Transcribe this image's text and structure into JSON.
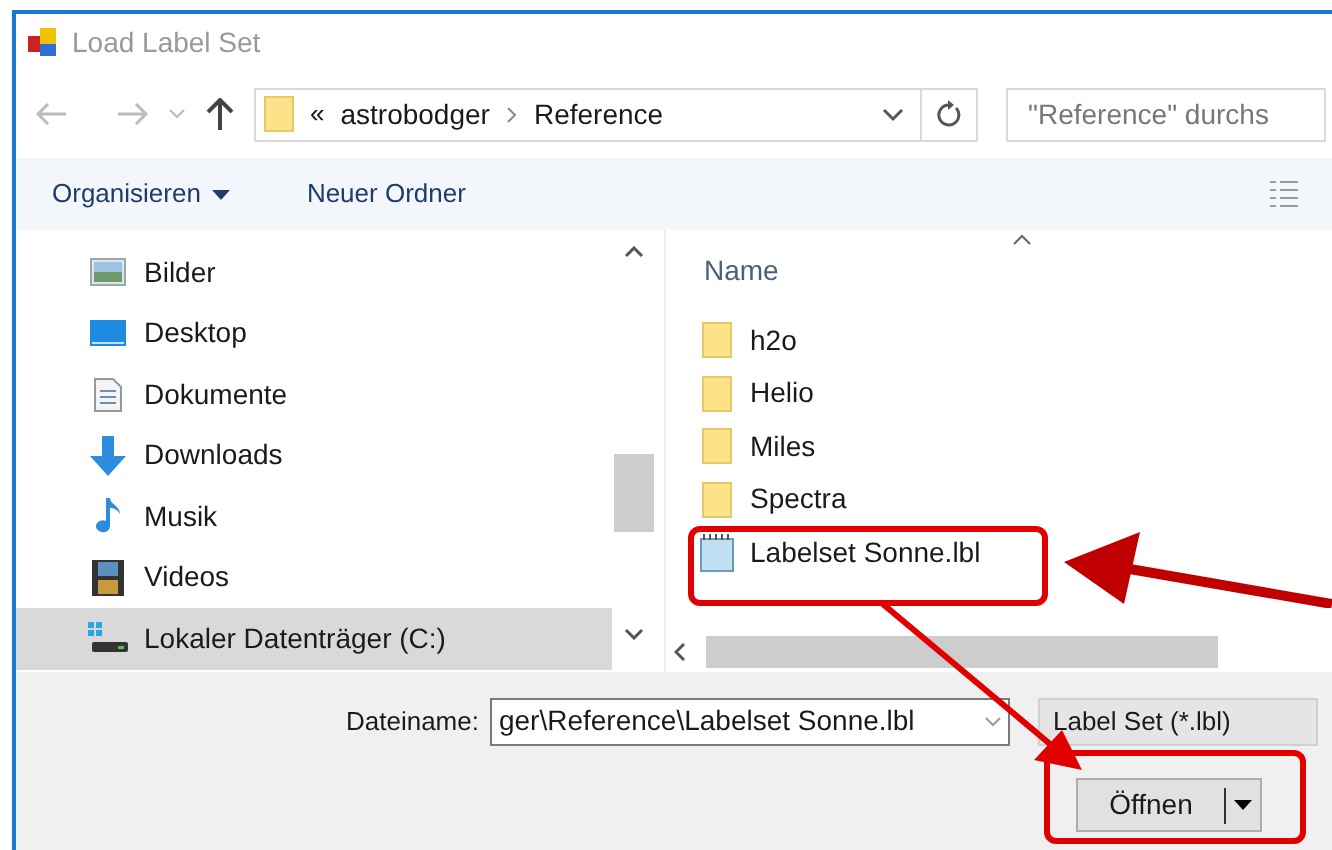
{
  "window": {
    "title": "Load Label Set"
  },
  "address_bar": {
    "overflow": "«",
    "segments": [
      "astrobodger",
      "Reference"
    ]
  },
  "search": {
    "placeholder": "\"Reference\" durchs"
  },
  "toolbar": {
    "organize": "Organisieren",
    "new_folder": "Neuer Ordner"
  },
  "nav_items": [
    {
      "label": "Bilder",
      "kind": "pictures",
      "selected": false
    },
    {
      "label": "Desktop",
      "kind": "desktop",
      "selected": false
    },
    {
      "label": "Dokumente",
      "kind": "documents",
      "selected": false
    },
    {
      "label": "Downloads",
      "kind": "downloads",
      "selected": false
    },
    {
      "label": "Musik",
      "kind": "music",
      "selected": false
    },
    {
      "label": "Videos",
      "kind": "videos",
      "selected": false
    },
    {
      "label": "Lokaler Datenträger (C:)",
      "kind": "drive",
      "selected": true
    }
  ],
  "file_list": {
    "column": "Name",
    "items": [
      {
        "label": "h2o",
        "kind": "folder"
      },
      {
        "label": "Helio",
        "kind": "folder"
      },
      {
        "label": "Miles",
        "kind": "folder"
      },
      {
        "label": "Spectra",
        "kind": "folder"
      },
      {
        "label": "Labelset Sonne.lbl",
        "kind": "file"
      }
    ]
  },
  "filename": {
    "label": "Dateiname:",
    "value": "ger\\Reference\\Labelset Sonne.lbl"
  },
  "file_type": {
    "value": "Label Set (*.lbl)"
  },
  "open_button": {
    "label": "Öffnen"
  }
}
